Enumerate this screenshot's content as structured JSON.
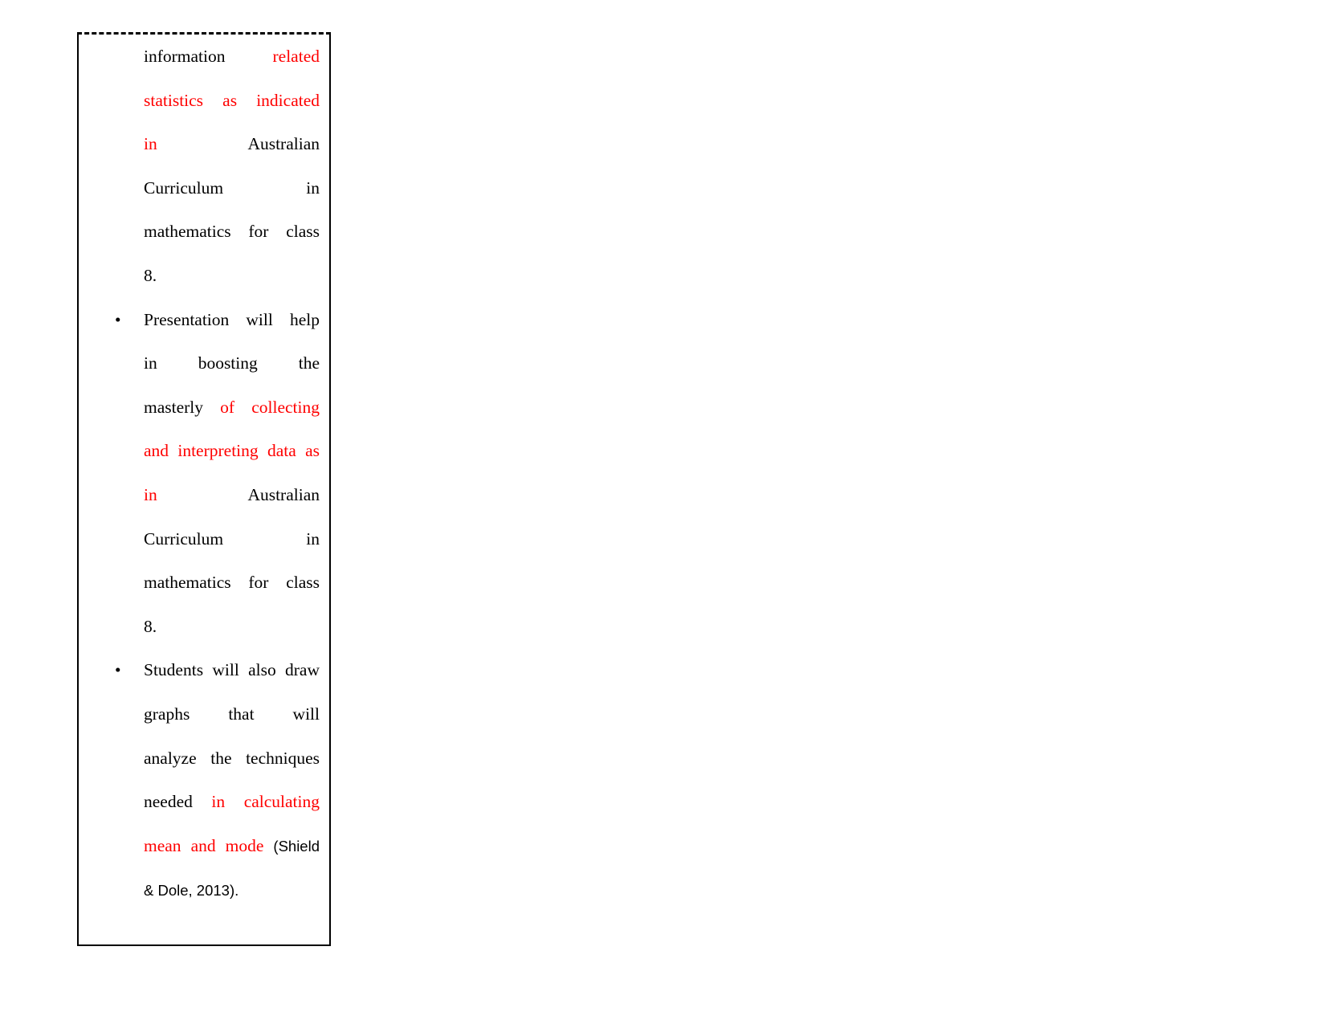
{
  "document": {
    "cell": {
      "border_top_style": "dashed",
      "border_color": "#000000",
      "background": "#ffffff"
    },
    "colors": {
      "highlight": "#ff0000",
      "text": "#000000"
    },
    "bullet_glyph": "•",
    "paragraphs": [
      {
        "id": "p1",
        "bulleted": false,
        "runs": [
          {
            "text": "information ",
            "color": "black",
            "font": "serif"
          },
          {
            "text": "related statistics as indicated in ",
            "color": "red",
            "font": "serif"
          },
          {
            "text": "Australian Curriculum in mathematics for class 8.",
            "color": "black",
            "font": "serif"
          }
        ],
        "lines": [
          {
            "segments": [
              {
                "text": "information",
                "color": "black"
              },
              {
                "text": "related",
                "color": "red"
              }
            ],
            "justified": true
          },
          {
            "segments": [
              {
                "text": "statistics",
                "color": "red"
              },
              {
                "text": "as",
                "color": "red"
              },
              {
                "text": "indicated",
                "color": "red"
              }
            ],
            "justified": true
          },
          {
            "segments": [
              {
                "text": "in",
                "color": "red"
              },
              {
                "text": "Australian",
                "color": "black"
              }
            ],
            "justified": true
          },
          {
            "segments": [
              {
                "text": "Curriculum",
                "color": "black"
              },
              {
                "text": "in",
                "color": "black"
              }
            ],
            "justified": true
          },
          {
            "segments": [
              {
                "text": "mathematics",
                "color": "black"
              },
              {
                "text": "for",
                "color": "black"
              },
              {
                "text": "class",
                "color": "black"
              }
            ],
            "justified": true
          },
          {
            "segments": [
              {
                "text": "8.",
                "color": "black"
              }
            ],
            "justified": false
          }
        ]
      },
      {
        "id": "p2",
        "bulleted": true,
        "runs": [
          {
            "text": "Presentation will help in boosting the masterly ",
            "color": "black",
            "font": "serif"
          },
          {
            "text": "of collecting and interpreting data as in ",
            "color": "red",
            "font": "serif"
          },
          {
            "text": "Australian Curriculum in mathematics for class 8.",
            "color": "black",
            "font": "serif"
          }
        ],
        "lines": [
          {
            "segments": [
              {
                "text": "Presentation",
                "color": "black"
              },
              {
                "text": "will",
                "color": "black"
              },
              {
                "text": "help",
                "color": "black"
              }
            ],
            "justified": true
          },
          {
            "segments": [
              {
                "text": "in",
                "color": "black"
              },
              {
                "text": "boosting",
                "color": "black"
              },
              {
                "text": "the",
                "color": "black"
              }
            ],
            "justified": true
          },
          {
            "segments": [
              {
                "text": "masterly",
                "color": "black"
              },
              {
                "text": "of",
                "color": "red"
              },
              {
                "text": "collecting",
                "color": "red"
              }
            ],
            "justified": true
          },
          {
            "segments": [
              {
                "text": "and",
                "color": "red"
              },
              {
                "text": "interpreting",
                "color": "red"
              },
              {
                "text": "data",
                "color": "red"
              },
              {
                "text": "as",
                "color": "red"
              }
            ],
            "justified": true
          },
          {
            "segments": [
              {
                "text": "in",
                "color": "red"
              },
              {
                "text": "Australian",
                "color": "black"
              }
            ],
            "justified": true
          },
          {
            "segments": [
              {
                "text": "Curriculum",
                "color": "black"
              },
              {
                "text": "in",
                "color": "black"
              }
            ],
            "justified": true
          },
          {
            "segments": [
              {
                "text": "mathematics",
                "color": "black"
              },
              {
                "text": "for",
                "color": "black"
              },
              {
                "text": "class",
                "color": "black"
              }
            ],
            "justified": true
          },
          {
            "segments": [
              {
                "text": "8.",
                "color": "black"
              }
            ],
            "justified": false
          }
        ]
      },
      {
        "id": "p3",
        "bulleted": true,
        "runs": [
          {
            "text": "Students will also draw graphs that will analyze the techniques needed ",
            "color": "black",
            "font": "serif"
          },
          {
            "text": "in calculating mean and mode ",
            "color": "red",
            "font": "serif"
          },
          {
            "text": "(Shield & Dole, 2013).",
            "color": "black",
            "font": "sans"
          }
        ],
        "lines": [
          {
            "segments": [
              {
                "text": "Students",
                "color": "black"
              },
              {
                "text": "will",
                "color": "black"
              },
              {
                "text": "also",
                "color": "black"
              },
              {
                "text": "draw",
                "color": "black"
              }
            ],
            "justified": true
          },
          {
            "segments": [
              {
                "text": "graphs",
                "color": "black"
              },
              {
                "text": "that",
                "color": "black"
              },
              {
                "text": "will",
                "color": "black"
              }
            ],
            "justified": true
          },
          {
            "segments": [
              {
                "text": "analyze",
                "color": "black"
              },
              {
                "text": "the",
                "color": "black"
              },
              {
                "text": "techniques",
                "color": "black"
              }
            ],
            "justified": true
          },
          {
            "segments": [
              {
                "text": "needed",
                "color": "black"
              },
              {
                "text": "in",
                "color": "red"
              },
              {
                "text": "calculating",
                "color": "red"
              }
            ],
            "justified": true
          },
          {
            "segments": [
              {
                "text": "mean and mode",
                "color": "red"
              },
              {
                "text": "(Shield",
                "color": "black",
                "font": "sans"
              }
            ],
            "justified": true
          },
          {
            "segments": [
              {
                "text": "& Dole, 2013).",
                "color": "black",
                "font": "sans"
              }
            ],
            "justified": false
          }
        ]
      }
    ],
    "text_lines": {
      "l1a": "information",
      "l1b": "related",
      "l2a": "statistics",
      "l2b": "as",
      "l2c": "indicated",
      "l3a": "in",
      "l3b": "Australian",
      "l4a": "Curriculum",
      "l4b": "in",
      "l5a": "mathematics",
      "l5b": "for",
      "l5c": "class",
      "l6a": "8.",
      "l7a": "Presentation",
      "l7b": "will",
      "l7c": "help",
      "l8a": "in",
      "l8b": "boosting",
      "l8c": "the",
      "l9a": "masterly",
      "l9b": "of",
      "l9c": "collecting",
      "l10a": "and",
      "l10b": "interpreting",
      "l10c": "data",
      "l10d": "as",
      "l11a": "in",
      "l11b": "Australian",
      "l12a": "Curriculum",
      "l12b": "in",
      "l13a": "mathematics",
      "l13b": "for",
      "l13c": "class",
      "l14a": "8.",
      "l15a": "Students",
      "l15b": "will",
      "l15c": "also",
      "l15d": "draw",
      "l16a": "graphs",
      "l16b": "that",
      "l16c": "will",
      "l17a": "analyze",
      "l17b": "the",
      "l17c": "techniques",
      "l18a": "needed",
      "l18b": "in",
      "l18c": "calculating",
      "l19a": "mean and mode",
      "l19b": "(Shield",
      "l20a": "& Dole, 2013)."
    },
    "bullets": {
      "b1": "•",
      "b2": "•"
    }
  }
}
